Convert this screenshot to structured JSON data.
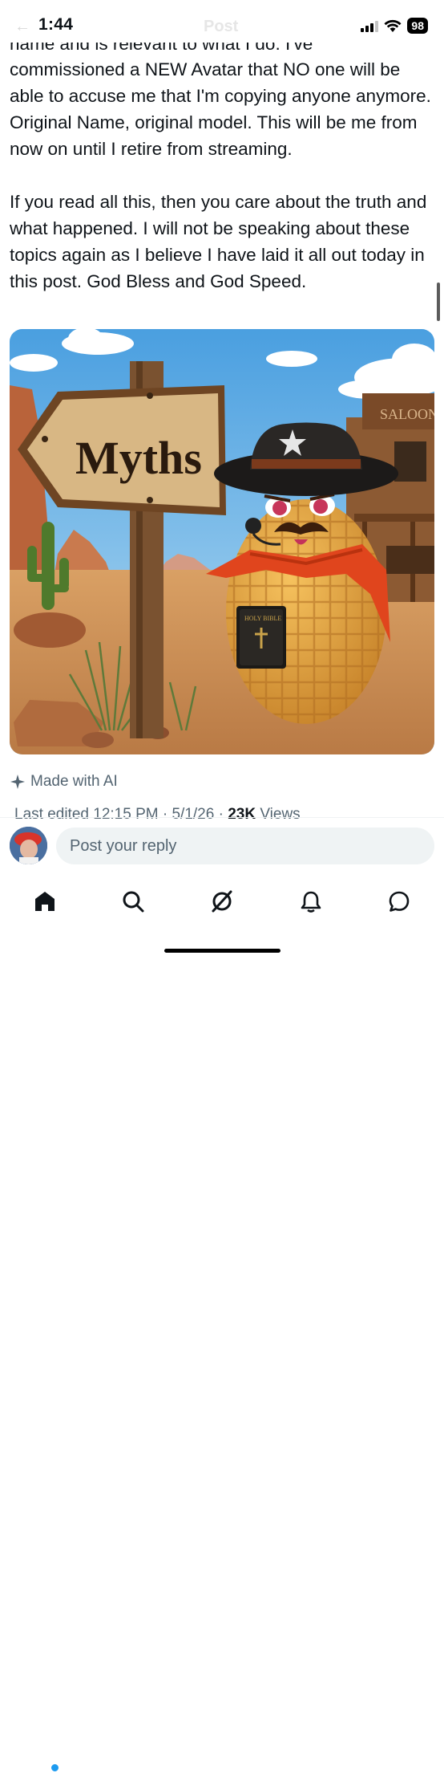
{
  "status_bar": {
    "time": "1:44",
    "battery": "98"
  },
  "nav": {
    "back_glyph": "←",
    "title": "Post"
  },
  "post": {
    "cut_top_line": "name and is relevant to what I do. I've",
    "paragraph_1": "commissioned a NEW Avatar that NO one will be able to accuse me that I'm copying anyone anymore. Original Name, original model. This will be me from now on until I retire from streaming.",
    "paragraph_2": "If you read all this, then you care about the truth and what happened. I will not be speaking about these topics again as I believe I have laid it all out today in this post. God Bless and God Speed."
  },
  "image": {
    "sign_text": "Myths",
    "saloon_text": "SALOON",
    "bible_text": "HOLY BIBLE"
  },
  "label": {
    "made_with": "Made with AI"
  },
  "meta": {
    "edited_prefix": "Last edited",
    "time": "12:15 PM",
    "date": "5/1/26",
    "views_count": "23K",
    "views_label": "Views"
  },
  "reply": {
    "placeholder": "Post your reply"
  },
  "tabs": [
    {
      "name": "home",
      "icon": "home-icon"
    },
    {
      "name": "search",
      "icon": "search-icon"
    },
    {
      "name": "grok",
      "icon": "grok-icon"
    },
    {
      "name": "notifications",
      "icon": "bell-icon"
    },
    {
      "name": "messages",
      "icon": "chat-icon"
    }
  ],
  "colors": {
    "accent": "#1d9bf0",
    "text": "#0f1419",
    "secondary": "#536471"
  }
}
